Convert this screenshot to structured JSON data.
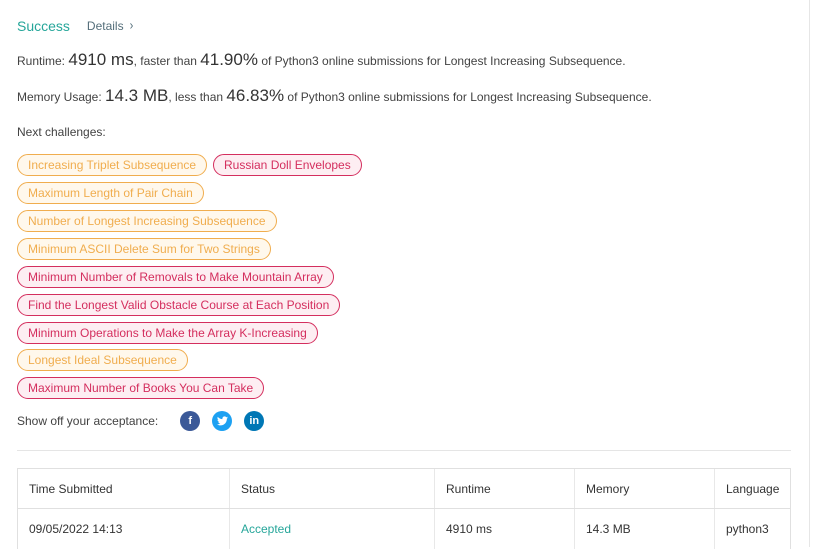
{
  "result": {
    "status": "Success",
    "details_label": "Details",
    "details_chevron": "›"
  },
  "runtime": {
    "label": "Runtime:",
    "value": "4910 ms",
    "comparator": ", faster than",
    "percent": "41.90%",
    "suffix": "of Python3 online submissions for Longest Increasing Subsequence."
  },
  "memory": {
    "label": "Memory Usage:",
    "value": "14.3 MB",
    "comparator": ", less than",
    "percent": "46.83%",
    "suffix": "of Python3 online submissions for Longest Increasing Subsequence."
  },
  "challenges": {
    "label": "Next challenges:",
    "items": [
      {
        "label": "Increasing Triplet Subsequence",
        "difficulty": "medium"
      },
      {
        "label": "Russian Doll Envelopes",
        "difficulty": "hard"
      },
      {
        "label": "Maximum Length of Pair Chain",
        "difficulty": "medium"
      },
      {
        "label": "Number of Longest Increasing Subsequence",
        "difficulty": "medium"
      },
      {
        "label": "Minimum ASCII Delete Sum for Two Strings",
        "difficulty": "medium"
      },
      {
        "label": "Minimum Number of Removals to Make Mountain Array",
        "difficulty": "hard"
      },
      {
        "label": "Find the Longest Valid Obstacle Course at Each Position",
        "difficulty": "hard"
      },
      {
        "label": "Minimum Operations to Make the Array K-Increasing",
        "difficulty": "hard"
      },
      {
        "label": "Longest Ideal Subsequence",
        "difficulty": "medium"
      },
      {
        "label": "Maximum Number of Books You Can Take",
        "difficulty": "hard"
      }
    ]
  },
  "share": {
    "label": "Show off your acceptance:",
    "icons": [
      {
        "name": "facebook-icon",
        "glyph": "f",
        "color": "#3b5998"
      },
      {
        "name": "twitter-icon",
        "glyph": "t",
        "color": "#1da1f2"
      },
      {
        "name": "linkedin-icon",
        "glyph": "in",
        "color": "#0077b5"
      }
    ]
  },
  "submissions": {
    "headers": [
      "Time Submitted",
      "Status",
      "Runtime",
      "Memory",
      "Language"
    ],
    "rows": [
      [
        "09/05/2022 14:13",
        "Accepted",
        "4910 ms",
        "14.3 MB",
        "python3"
      ]
    ]
  },
  "colors": {
    "accent": "#26a69a",
    "medium": "#f0ad4e",
    "hard": "#d42e5e"
  }
}
